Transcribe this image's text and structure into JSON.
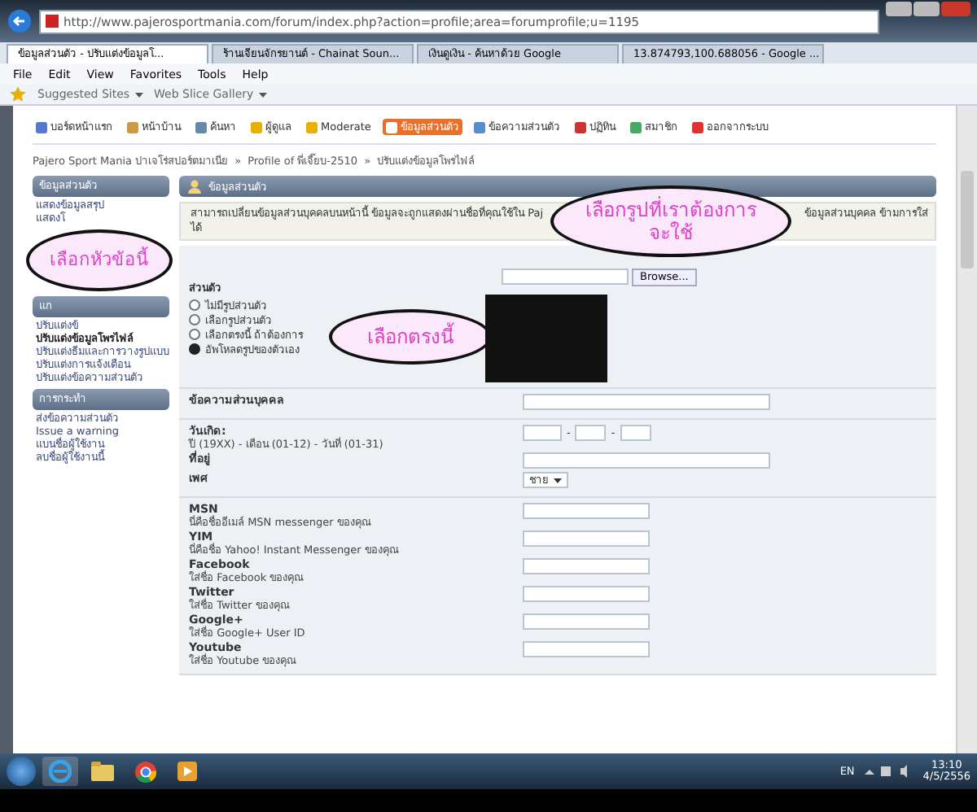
{
  "browser": {
    "url": "http://www.pajerosportmania.com/forum/index.php?action=profile;area=forumprofile;u=1195",
    "tabs": [
      {
        "label": "ข้อมูลส่วนตัว - ปรับแต่งข้อมูลโ...",
        "selected": true
      },
      {
        "label": "ร้านเจียนจักรยานต์ - Chainat Soun...",
        "selected": false
      },
      {
        "label": "เงินดูเงิน - ค้นหาด้วย Google",
        "selected": false
      },
      {
        "label": "13.874793,100.688056 - Google ...",
        "selected": false
      }
    ],
    "menu": [
      "File",
      "Edit",
      "View",
      "Favorites",
      "Tools",
      "Help"
    ],
    "favorites": [
      "Suggested Sites",
      "Web Slice Gallery"
    ]
  },
  "nav": [
    {
      "label": "บอร์ดหน้าแรก",
      "selected": false
    },
    {
      "label": "หน้าบ้าน",
      "selected": false
    },
    {
      "label": "ค้นหา",
      "selected": false
    },
    {
      "label": "ผู้ดูแล",
      "selected": false
    },
    {
      "label": "Moderate",
      "selected": false
    },
    {
      "label": "ข้อมูลส่วนตัว",
      "selected": true
    },
    {
      "label": "ข้อความส่วนตัว",
      "selected": false
    },
    {
      "label": "ปฏิทิน",
      "selected": false
    },
    {
      "label": "สมาชิก",
      "selected": false
    },
    {
      "label": "ออกจากระบบ",
      "selected": false
    }
  ],
  "breadcrumb": {
    "items": [
      "Pajero Sport Mania ปาเจโร่สปอร์ตมาเนีย",
      "Profile of พี่เจี๊ยบ-2510",
      "ปรับแต่งข้อมูลโพรไฟล์"
    ],
    "separator": "»"
  },
  "sidebar": [
    {
      "title": "ข้อมูลส่วนตัว",
      "items": [
        {
          "label": "แสดงข้อมูลสรุป",
          "selected": false
        },
        {
          "label": "แสดงโ",
          "selected": false
        }
      ]
    },
    {
      "title": "แก",
      "items": [
        {
          "label": "ปรับแต่งข้",
          "selected": false
        },
        {
          "label": "ปรับแต่งข้อมูลโพรไฟล์",
          "selected": true
        },
        {
          "label": "ปรับแต่งธีมและการวางรูปแบบ",
          "selected": false
        },
        {
          "label": "ปรับแต่งการแจ้งเตือน",
          "selected": false
        },
        {
          "label": "ปรับแต่งข้อความส่วนตัว",
          "selected": false
        }
      ]
    },
    {
      "title": "การกระทำ",
      "items": [
        {
          "label": "ส่งข้อความส่วนตัว",
          "selected": false
        },
        {
          "label": "Issue a warning",
          "selected": false
        },
        {
          "label": "แบนชื่อผู้ใช้งาน",
          "selected": false
        },
        {
          "label": "ลบชื่อผู้ใช้งานนี้",
          "selected": false
        }
      ]
    }
  ],
  "profile": {
    "title": "ข้อมูลส่วนตัว",
    "info": [
      "สามารถเปลี่ยนข้อมูลส่วนบุคคลบนหน้านี้ ข้อมูลจะถูกแสดงผ่านชื่อที่คุณใช้ใน Paj",
      "ข้อมูลส่วนบุคคล ข้ามการใส่",
      "ได้"
    ],
    "avatar_label": "ส่วนตัว",
    "avatar_options": [
      {
        "label": "ไม่มีรูปส่วนตัว",
        "selected": false
      },
      {
        "label": "เลือกรูปส่วนตัว",
        "selected": false
      },
      {
        "label": "เลือกตรงนี้ ถ้าต้องการ",
        "selected": false
      },
      {
        "label": "อัพโหลดรูปของตัวเอง",
        "selected": true
      }
    ],
    "browse_button": "Browse..."
  },
  "sections": [
    [
      {
        "kind": "text",
        "label": "ข้อความส่วนบุคคล",
        "wide": true
      }
    ],
    [
      {
        "kind": "date",
        "label": "วันเกิด:",
        "hint": "ปี (19XX) - เดือน (01-12) - วันที่ (01-31)",
        "separators": [
          "-",
          "-"
        ]
      },
      {
        "kind": "text",
        "label": "ที่อยู่",
        "wide": true
      },
      {
        "kind": "select",
        "label": "เพศ",
        "value": "ชาย"
      }
    ],
    [
      {
        "kind": "text",
        "label": "MSN",
        "hint": "นี่คือชื่ออีเมล์ MSN messenger ของคุณ",
        "wide": false
      },
      {
        "kind": "text",
        "label": "YIM",
        "hint": "นี่คือชื่อ Yahoo! Instant Messenger ของคุณ",
        "wide": false
      },
      {
        "kind": "text",
        "label": "Facebook",
        "hint": "ใส่ชื่อ Facebook ของคุณ",
        "wide": false
      },
      {
        "kind": "text",
        "label": "Twitter",
        "hint": "ใส่ชื่อ Twitter ของคุณ",
        "wide": false
      },
      {
        "kind": "text",
        "label": "Google+",
        "hint": "ใส่ชื่อ Google+ User ID",
        "wide": false
      },
      {
        "kind": "text",
        "label": "Youtube",
        "hint": "ใส่ชื่อ Youtube ของคุณ",
        "wide": false
      }
    ]
  ],
  "callouts": [
    [
      "เลือกหัวข้อนี้"
    ],
    [
      "เลือกตรงนี้"
    ],
    [
      "เลือกรูปที่เราต้องการ",
      "จะใช้"
    ]
  ],
  "taskbar": {
    "language": "EN",
    "time": "13:10",
    "date": "4/5/2556"
  }
}
